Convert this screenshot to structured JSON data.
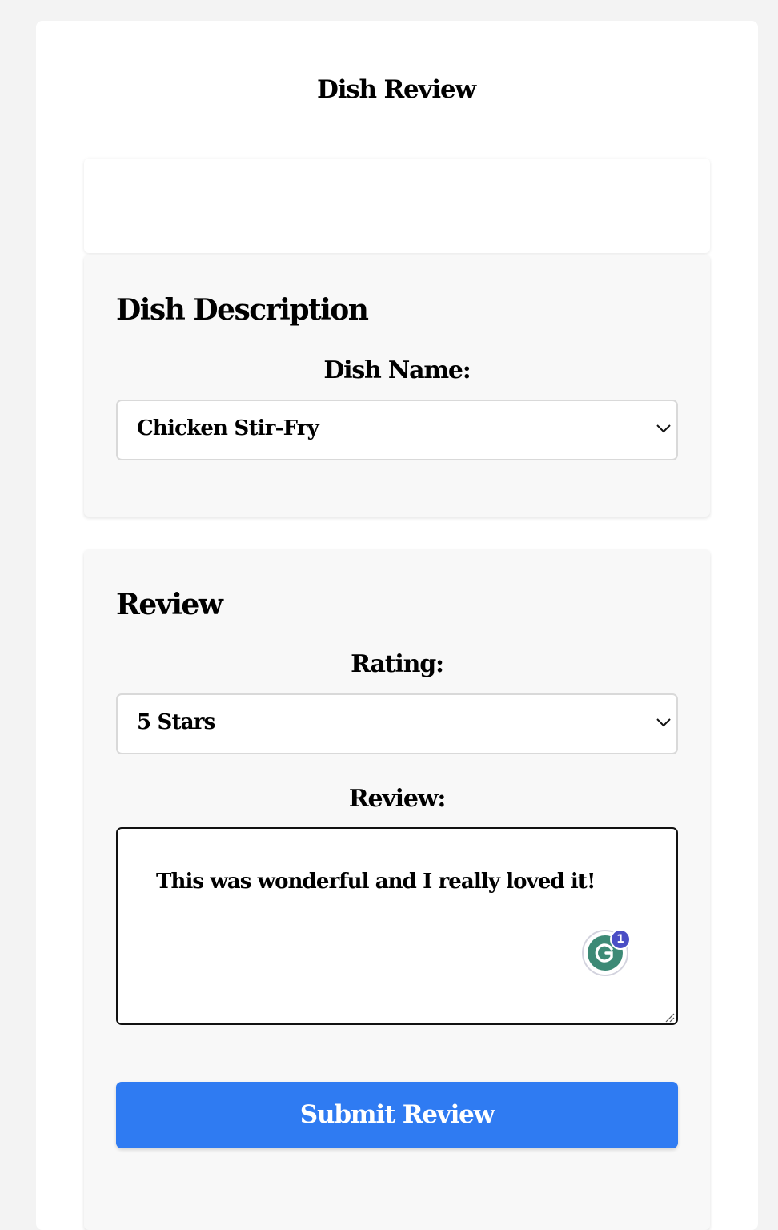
{
  "page": {
    "title": "Dish Review"
  },
  "description_section": {
    "title": "Dish Description",
    "dish_name_label": "Dish Name:",
    "dish_name_value": "Chicken Stir-Fry"
  },
  "review_section": {
    "title": "Review",
    "rating_label": "Rating:",
    "rating_value": "5 Stars",
    "review_label": "Review:",
    "review_text": "This was wonderful and I really loved it!",
    "grammarly_badge_count": "1",
    "submit_label": "Submit Review"
  },
  "colors": {
    "background": "#f3f3f3",
    "card": "#ffffff",
    "section": "#f8f8f8",
    "accent": "#2f7bf2",
    "grammarly_green": "#3d8a76",
    "grammarly_badge": "#4a4ec5"
  },
  "icons": {
    "select_arrow": "chevron-down-icon",
    "grammarly": "grammarly-icon",
    "resize": "resize-handle-icon"
  }
}
